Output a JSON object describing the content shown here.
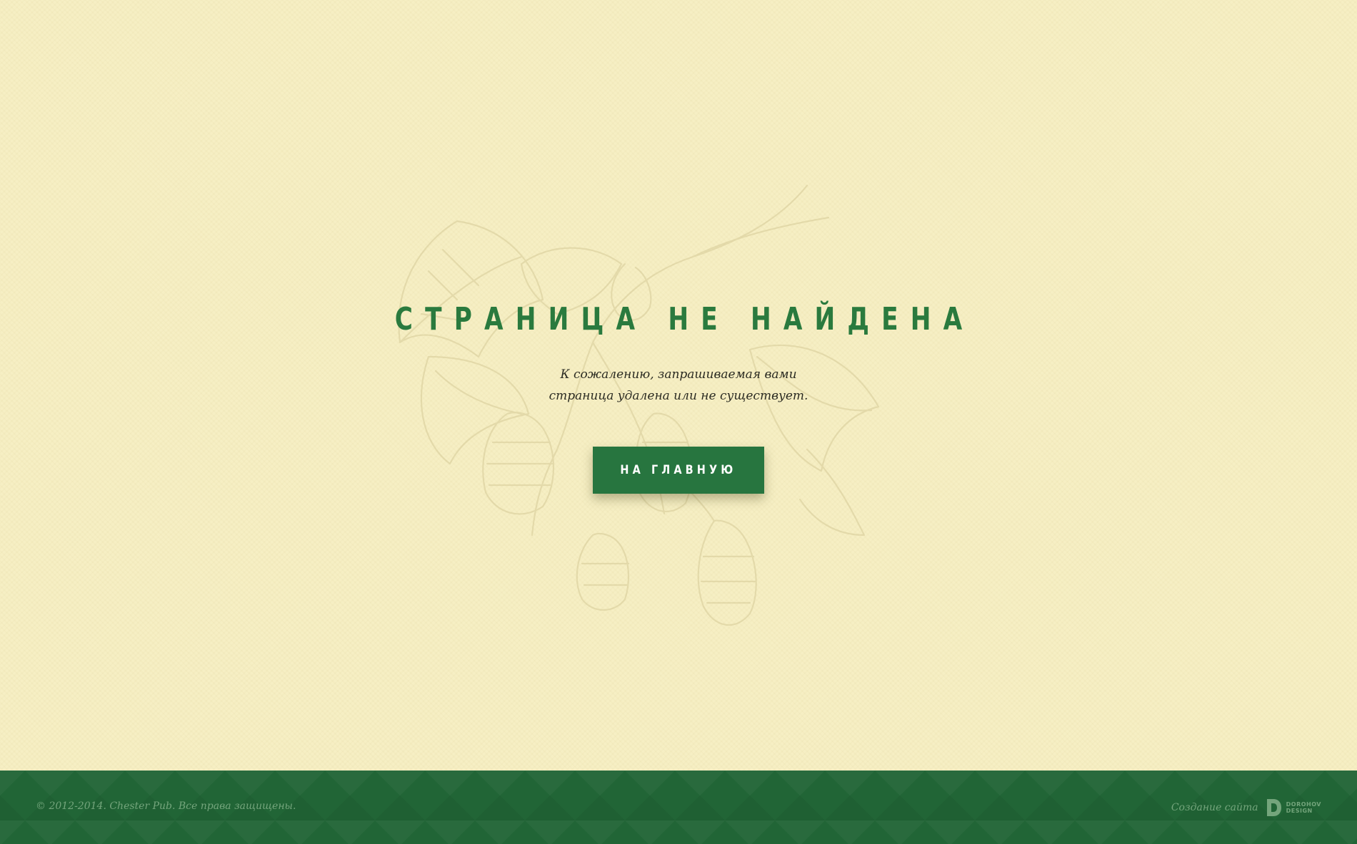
{
  "page": {
    "title": "СТРАНИЦА НЕ НАЙДЕНА",
    "message_line1": "К сожалению, запрашиваемая вами",
    "message_line2": "страница удалена или не существует.",
    "home_button_label": "НА ГЛАВНУЮ"
  },
  "footer": {
    "copyright": "© 2012-2014. Chester Pub. Все права защищены.",
    "credit_text": "Создание сайта",
    "studio_logo_line1": "DOROHOV",
    "studio_logo_line2": "DESIGN"
  },
  "colors": {
    "background": "#f6efc4",
    "accent_green": "#27753f",
    "footer_green": "#216536",
    "footer_text": "#74a57c",
    "illustration": "#d9cfa0"
  },
  "icons": {
    "background_art": "hops-branch-illustration",
    "studio_logo": "dorohov-design-logo"
  }
}
